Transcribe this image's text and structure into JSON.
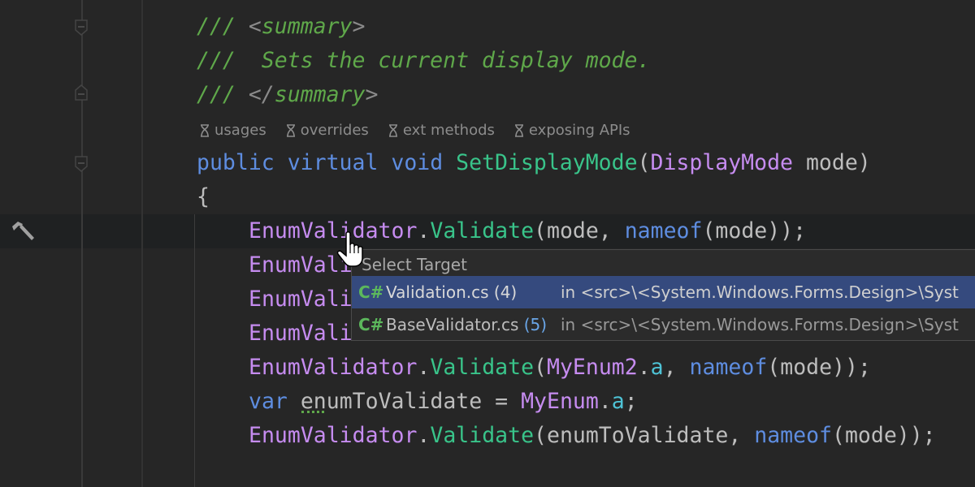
{
  "code": {
    "doc": [
      "/// ",
      "<",
      "summary",
      ">"
    ],
    "doc_text": "///  Sets the current display mode.",
    "doc_end": [
      "/// ",
      "</",
      "summary",
      ">"
    ],
    "hints": [
      "usages",
      "overrides",
      "ext methods",
      "exposing APIs"
    ],
    "signature": {
      "kw1": "public",
      "kw2": "virtual",
      "kw3": "void",
      "name": "SetDisplayMode",
      "open": "(",
      "type": "DisplayMode",
      "param": " mode)"
    },
    "brace": "{",
    "line1": {
      "cls": "EnumValidator",
      "dot": ".",
      "fn": "Validate",
      "a": "(mode, ",
      "kw": "nameof",
      "b": "(mode));"
    },
    "line2": "EnumVali",
    "line3": "EnumVali",
    "line4": "EnumVali",
    "line5": {
      "cls": "EnumValidator",
      "dot": ".",
      "fn": "Validate",
      "a": "(",
      "enum": "MyEnum2",
      "dot2": ".",
      "mem": "a",
      "b": ", ",
      "kw": "nameof",
      "c": "(mode));"
    },
    "line6": {
      "kw": "var",
      "sp": " ",
      "var": "enumToValidate",
      "eq": " = ",
      "enum": "MyEnum",
      "dot": ".",
      "mem": "a",
      "end": ";"
    },
    "line7": {
      "cls": "EnumValidator",
      "dot": ".",
      "fn": "Validate",
      "a": "(enumToValidate, ",
      "kw": "nameof",
      "b": "(mode));"
    }
  },
  "popup": {
    "title": "Select Target",
    "items": [
      {
        "lang": "C#",
        "file": "Validation.cs",
        "count": "(4)",
        "location": "in <src>\\<System.Windows.Forms.Design>\\Syst",
        "selected": true
      },
      {
        "lang": "C#",
        "file": "BaseValidator.cs",
        "count": "(5)",
        "location": "in <src>\\<System.Windows.Forms.Design>\\Syst",
        "selected": false
      }
    ]
  },
  "icons": {
    "gutter": "hammer-icon",
    "hint": "hourglass-icon",
    "cursor": "hand-pointer-icon"
  },
  "colors": {
    "background": "#262626",
    "selection": "#354a7e",
    "comment": "#5fa84a",
    "keyword": "#5e8de0",
    "method": "#39c48a",
    "type": "#c68cf0"
  }
}
